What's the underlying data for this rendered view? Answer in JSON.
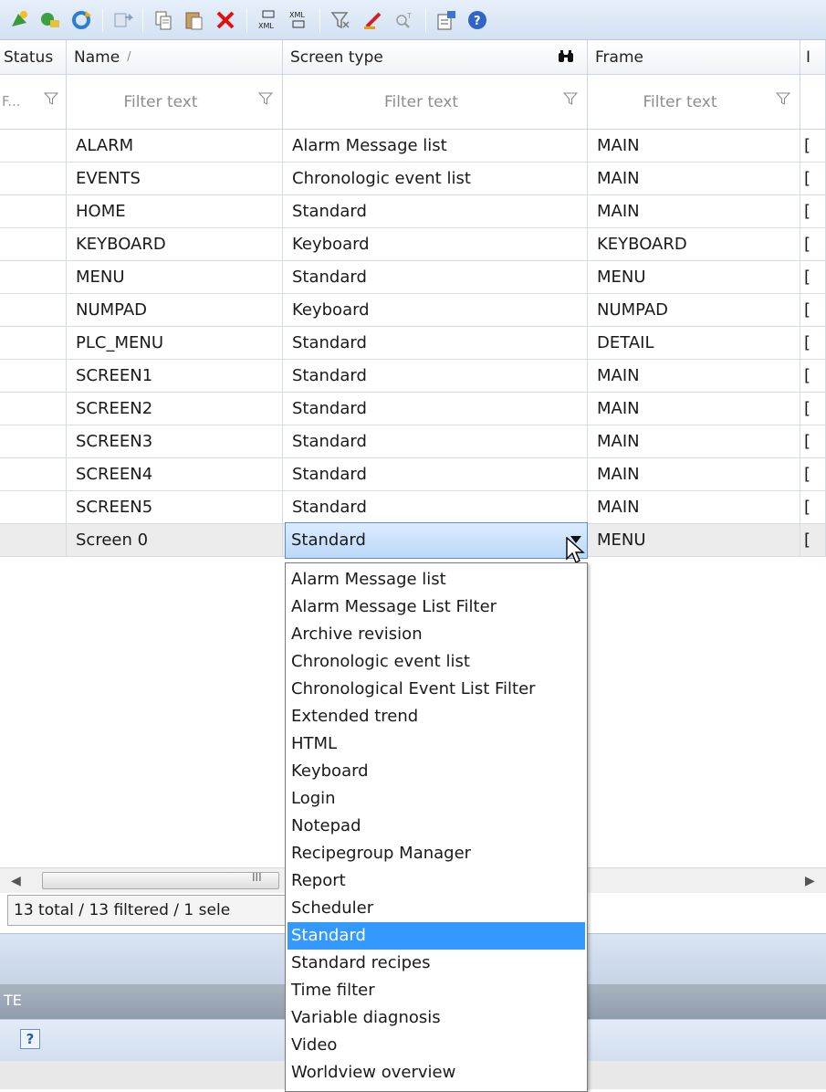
{
  "toolbar": {
    "buttons": [
      "new-screen-icon",
      "add-screen-icon",
      "refresh-icon",
      "rename-icon",
      "copy-icon",
      "paste-icon",
      "delete-icon",
      "export-xml-icon",
      "import-xml-icon",
      "clear-filter-icon",
      "edit-icon",
      "find-icon",
      "properties-icon",
      "help-icon"
    ]
  },
  "columns": {
    "status": "Status",
    "name": "Name",
    "name_sort": "/",
    "screen_type": "Screen type",
    "frame": "Frame",
    "next": "I"
  },
  "filter": {
    "status": "F...",
    "name": "Filter text",
    "screen_type": "Filter text",
    "frame": "Filter text"
  },
  "rows": [
    {
      "name": "ALARM",
      "type": "Alarm Message list",
      "frame": "MAIN",
      "extra": "["
    },
    {
      "name": "EVENTS",
      "type": "Chronologic event list",
      "frame": "MAIN",
      "extra": "["
    },
    {
      "name": "HOME",
      "type": "Standard",
      "frame": "MAIN",
      "extra": "["
    },
    {
      "name": "KEYBOARD",
      "type": "Keyboard",
      "frame": "KEYBOARD",
      "extra": "["
    },
    {
      "name": "MENU",
      "type": "Standard",
      "frame": "MENU",
      "extra": "["
    },
    {
      "name": "NUMPAD",
      "type": "Keyboard",
      "frame": "NUMPAD",
      "extra": "["
    },
    {
      "name": "PLC_MENU",
      "type": "Standard",
      "frame": "DETAIL",
      "extra": "["
    },
    {
      "name": "SCREEN1",
      "type": "Standard",
      "frame": "MAIN",
      "extra": "["
    },
    {
      "name": "SCREEN2",
      "type": "Standard",
      "frame": "MAIN",
      "extra": "["
    },
    {
      "name": "SCREEN3",
      "type": "Standard",
      "frame": "MAIN",
      "extra": "["
    },
    {
      "name": "SCREEN4",
      "type": "Standard",
      "frame": "MAIN",
      "extra": "["
    },
    {
      "name": "SCREEN5",
      "type": "Standard",
      "frame": "MAIN",
      "extra": "["
    },
    {
      "name": "Screen 0",
      "type": "Standard",
      "frame": "MENU",
      "extra": "["
    }
  ],
  "editor": {
    "value": "Standard",
    "options": [
      "Alarm Message list",
      "Alarm Message List Filter",
      "Archive revision",
      "Chronologic event list",
      "Chronological Event List Filter",
      "Extended trend",
      "HTML",
      "Keyboard",
      "Login",
      "Notepad",
      "Recipegroup Manager",
      "Report",
      "Scheduler",
      "Standard",
      "Standard recipes",
      "Time filter",
      "Variable diagnosis",
      "Video",
      "Worldview overview"
    ],
    "highlighted": "Standard"
  },
  "scroll": {
    "grip": "III"
  },
  "status_bar": {
    "text": "13 total / 13 filtered / 1 sele"
  },
  "panel": {
    "label": "TE",
    "help": "?"
  }
}
